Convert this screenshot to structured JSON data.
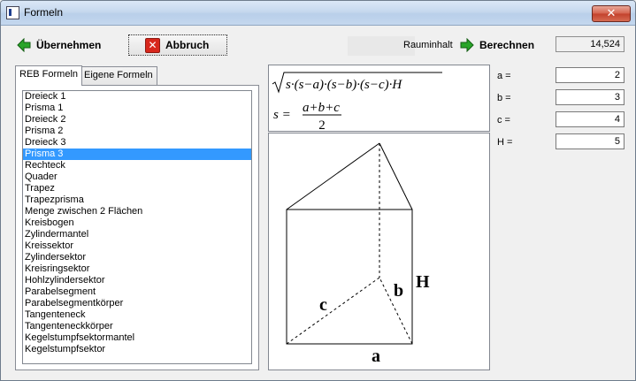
{
  "window": {
    "title": "Formeln",
    "close_glyph": "✕"
  },
  "toolbar": {
    "accept_label": "Übernehmen",
    "cancel_label": "Abbruch",
    "result_label": "Rauminhalt",
    "calculate_label": "Berechnen",
    "result_value": "14,524"
  },
  "icons": {
    "accept": "green-arrow-left-icon",
    "cancel": "red-x-icon",
    "calculate": "green-arrow-right-icon",
    "cancel_glyph": "✕"
  },
  "tabs": [
    {
      "label": "REB Formeln",
      "active": true
    },
    {
      "label": "Eigene Formeln",
      "active": false
    }
  ],
  "formulas": [
    "Dreieck 1",
    "Prisma 1",
    "Dreieck 2",
    "Prisma 2",
    "Dreieck 3",
    "Prisma 3",
    "Rechteck",
    "Quader",
    "Trapez",
    "Trapezprisma",
    "Menge zwischen 2 Flächen",
    "Kreisbogen",
    "Zylindermantel",
    "Kreissektor",
    "Zylindersektor",
    "Kreisringsektor",
    "Hohlzylindersektor",
    "Parabelsegment",
    "Parabelsegmentkörper",
    "Tangenteneck",
    "Tangenteneckkörper",
    "Kegelstumpfsektormantel",
    "Kegelstumpfsektor"
  ],
  "selected_formula": "Prisma 3",
  "formula_display": {
    "line1": "s·(s−a)·(s−b)·(s−c)·H",
    "s_lhs": "s =",
    "numerator": "a+b+c",
    "denominator": "2"
  },
  "drawing_labels": {
    "a": "a",
    "b": "b",
    "c": "c",
    "H": "H"
  },
  "parameters": [
    {
      "label": "a =",
      "value": "2"
    },
    {
      "label": "b =",
      "value": "3"
    },
    {
      "label": "c =",
      "value": "4"
    },
    {
      "label": "H =",
      "value": "5"
    }
  ],
  "colors": {
    "selection": "#3399ff",
    "arrow_green": "#2aa52a",
    "close_red": "#c2412c"
  }
}
